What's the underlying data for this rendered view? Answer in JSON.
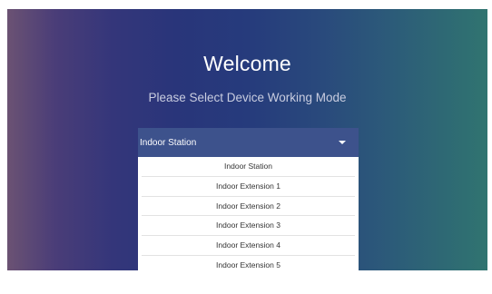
{
  "welcome": {
    "title": "Welcome",
    "subtitle": "Please Select Device Working Mode"
  },
  "mode_select": {
    "selected": "Indoor Station",
    "options": [
      "Indoor Station",
      "Indoor Extension 1",
      "Indoor Extension 2",
      "Indoor Extension 3",
      "Indoor Extension 4",
      "Indoor Extension 5"
    ]
  },
  "colors": {
    "select_bg": "#3d528c",
    "text_light": "#ffffff",
    "subtitle": "#c9cde0"
  },
  "icons": {
    "dropdown": "chevron-down-icon"
  }
}
